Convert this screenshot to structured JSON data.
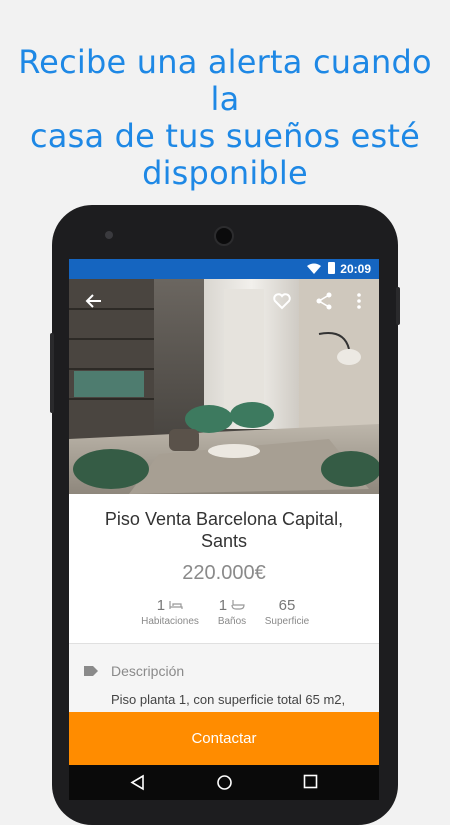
{
  "headline": {
    "line1": "Recibe una alerta cuando la",
    "line2": "casa de tus sueños esté",
    "line3": "disponible"
  },
  "status_bar": {
    "time": "20:09"
  },
  "toolbar": {
    "back_icon": "arrow-back-icon",
    "favorite_icon": "heart-outline-icon",
    "share_icon": "share-icon",
    "more_icon": "more-vert-icon"
  },
  "listing": {
    "title_line1": "Piso Venta Barcelona Capital,",
    "title_line2": "Sants",
    "price": "220.000€",
    "features": [
      {
        "value": "1",
        "label": "Habitaciones",
        "icon": "bed-icon"
      },
      {
        "value": "1",
        "label": "Baños",
        "icon": "bathtub-icon"
      },
      {
        "value": "65",
        "label": "Superficie",
        "icon": ""
      }
    ],
    "description_label": "Descripción",
    "description_text": "Piso planta 1, con superficie total 65 m2,"
  },
  "actions": {
    "contact_label": "Contactar"
  },
  "colors": {
    "headline": "#1e88e5",
    "status_bar": "#1565c0",
    "contact": "#ff8c00"
  }
}
